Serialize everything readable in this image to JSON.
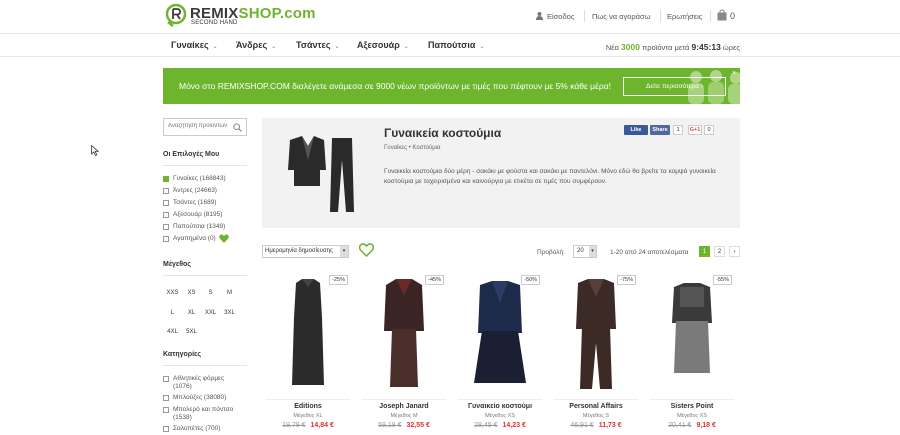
{
  "header": {
    "logo_main_a": "REMIX",
    "logo_main_b": "SHOP.com",
    "logo_sub": "SECOND HAND",
    "links": {
      "login": "Είσοδος",
      "how_to_buy": "Πως να αγοράσω",
      "faq": "Ερωτήσεις",
      "cart_count": "0"
    }
  },
  "nav": {
    "items": [
      {
        "label": "Γυναίκες"
      },
      {
        "label": "Άνδρες"
      },
      {
        "label": "Τσάντες"
      },
      {
        "label": "Αξεσουάρ"
      },
      {
        "label": "Παπούτσια"
      }
    ],
    "stats_prefix": "Νέα",
    "stats_number": "3000",
    "stats_middle": "προϊόντα μετά",
    "stats_time": "9:45:13",
    "stats_suffix": "ώρες"
  },
  "banner": {
    "text": "Μόνο στο REMIXSHOP.COM διαλέγετε ανάμεσα σε 9000 νέων προϊόντων με τιμές που πέφτουν με 5% κάθε μέρα!",
    "button": "Δείτε περισσότερα",
    "close": "×",
    "brand_color": "#6cb52d"
  },
  "sidebar": {
    "search_placeholder": "Αναζήτηση προϊόντων",
    "my_options_title": "Οι Επιλογές Μου",
    "options": [
      {
        "label": "Γυναίκες (168843)",
        "checked": true
      },
      {
        "label": "Άντρες (24663)",
        "checked": false
      },
      {
        "label": "Τσάντες (1689)",
        "checked": false
      },
      {
        "label": "Αξεσουάρ (8195)",
        "checked": false
      },
      {
        "label": "Παπούτσια (1349)",
        "checked": false
      },
      {
        "label": "Αγαπημένα (0)",
        "checked": false
      }
    ],
    "size_title": "Μέγεθος",
    "sizes": [
      "XXS",
      "XS",
      "S",
      "M",
      "L",
      "XL",
      "XXL",
      "3XL",
      "4XL",
      "5XL"
    ],
    "categories_title": "Κατηγορίες",
    "categories": [
      {
        "label": "Αθλητικές φόρμες",
        "count": "(1076)"
      },
      {
        "label": "Μπλούζες (38080)"
      },
      {
        "label": "Μπολερό και πόντσο",
        "count": "(1538)"
      },
      {
        "label": "Σαλοπέτες (700)"
      }
    ]
  },
  "category": {
    "title": "Γυναικεία κοστούμια",
    "breadcrumb": "Γυναίκες • Κοστούμια",
    "description": "Γυναικεία κοστούμια δύο μέρη - σακάκι με φούστα και σακάκι με παντελόνι. Μόνο εδώ θα βρείτε τα κομψά γυναικεία κοστούμια με ταχειρισμένα και καινούργια με ετικέτα σε τιμές που συμφέρουν.",
    "social": {
      "like": "Like",
      "share": "Share",
      "fb_count": "1",
      "gplus": "G+1",
      "gplus_count": "0"
    }
  },
  "toolbar": {
    "sort_label": "Ημερομηνία δημοσίευσης",
    "view_label": "Προβολή:",
    "per_page": "20",
    "results": "1-20 από 24 αποτελέσματα",
    "pages": [
      "1",
      "2",
      "›"
    ]
  },
  "products": [
    {
      "brand": "Editions",
      "size": "Μέγεθος XL",
      "old": "19,79 €",
      "new": "14,84 €",
      "discount": "-25%"
    },
    {
      "brand": "Joseph Janard",
      "size": "Μέγεθος M",
      "old": "59,18 €",
      "new": "32,55 €",
      "discount": "-45%"
    },
    {
      "brand": "Γυναικείο κοστούμι",
      "size": "Μέγεθος XS",
      "old": "28,45 €",
      "new": "14,23 €",
      "discount": "-50%"
    },
    {
      "brand": "Personal Affairs",
      "size": "Μέγεθος S",
      "old": "46,91 €",
      "new": "11,73 €",
      "discount": "-75%"
    },
    {
      "brand": "Sisters Point",
      "size": "Μέγεθος XS",
      "old": "20,41 €",
      "new": "9,18 €",
      "discount": "-55%"
    }
  ],
  "icons": [
    "logo-icon",
    "user-icon",
    "bag-icon",
    "search-icon",
    "heart-icon",
    "cursor-icon"
  ]
}
